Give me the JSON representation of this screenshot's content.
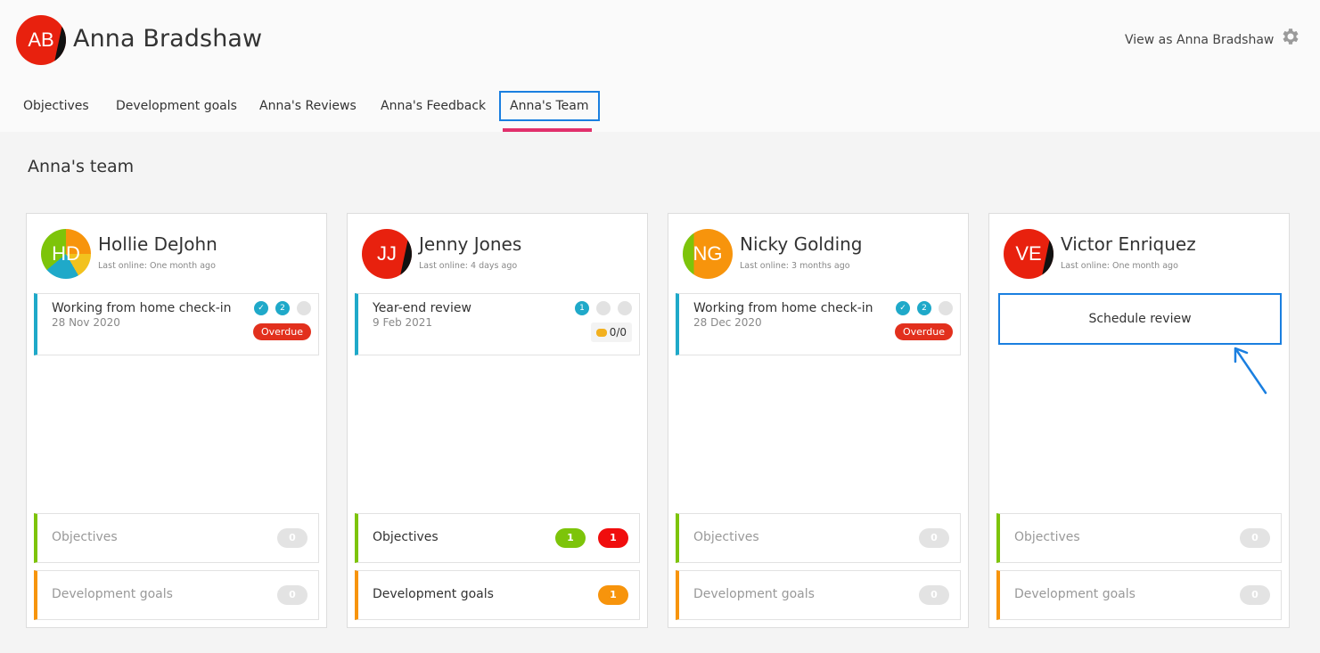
{
  "header": {
    "user_initials": "AB",
    "user_name": "Anna Bradshaw",
    "view_as": "View as Anna Bradshaw",
    "settings_icon": "gear-icon"
  },
  "tabs": [
    {
      "label": "Objectives"
    },
    {
      "label": "Development goals"
    },
    {
      "label": "Anna's Reviews"
    },
    {
      "label": "Anna's Feedback"
    },
    {
      "label": "Anna's Team",
      "active": true
    }
  ],
  "section_title": "Anna's team",
  "team": [
    {
      "initials": "HD",
      "name": "Hollie DeJohn",
      "last_online": "Last online: One month ago",
      "review": {
        "title": "Working from home check-in",
        "date": "28 Nov 2020",
        "steps": [
          "✓",
          "2",
          ""
        ],
        "status": "Overdue"
      },
      "objectives": {
        "label": "Objectives",
        "counts": [
          "0"
        ]
      },
      "development_goals": {
        "label": "Development goals",
        "counts": [
          "0"
        ]
      }
    },
    {
      "initials": "JJ",
      "name": "Jenny Jones",
      "last_online": "Last online: 4 days ago",
      "review": {
        "title": "Year-end review",
        "date": "9 Feb 2021",
        "steps": [
          "1",
          "",
          ""
        ],
        "comments": "0/0"
      },
      "objectives": {
        "label": "Objectives",
        "counts": [
          "1",
          "1"
        ]
      },
      "development_goals": {
        "label": "Development goals",
        "counts": [
          "1"
        ]
      }
    },
    {
      "initials": "NG",
      "name": "Nicky Golding",
      "last_online": "Last online: 3 months ago",
      "review": {
        "title": "Working from home check-in",
        "date": "28 Dec 2020",
        "steps": [
          "✓",
          "2",
          ""
        ],
        "status": "Overdue"
      },
      "objectives": {
        "label": "Objectives",
        "counts": [
          "0"
        ]
      },
      "development_goals": {
        "label": "Development goals",
        "counts": [
          "0"
        ]
      }
    },
    {
      "initials": "VE",
      "name": "Victor Enriquez",
      "last_online": "Last online: One month ago",
      "schedule_label": "Schedule review",
      "objectives": {
        "label": "Objectives",
        "counts": [
          "0"
        ]
      },
      "development_goals": {
        "label": "Development goals",
        "counts": [
          "0"
        ]
      }
    }
  ],
  "colors": {
    "accent": "#1a7fe0",
    "tab_underline": "#e1306c",
    "review_bar": "#1fa9c9",
    "objectives_bar": "#7dc40a",
    "goals_bar": "#f7940c",
    "overdue": "#e2301d"
  }
}
